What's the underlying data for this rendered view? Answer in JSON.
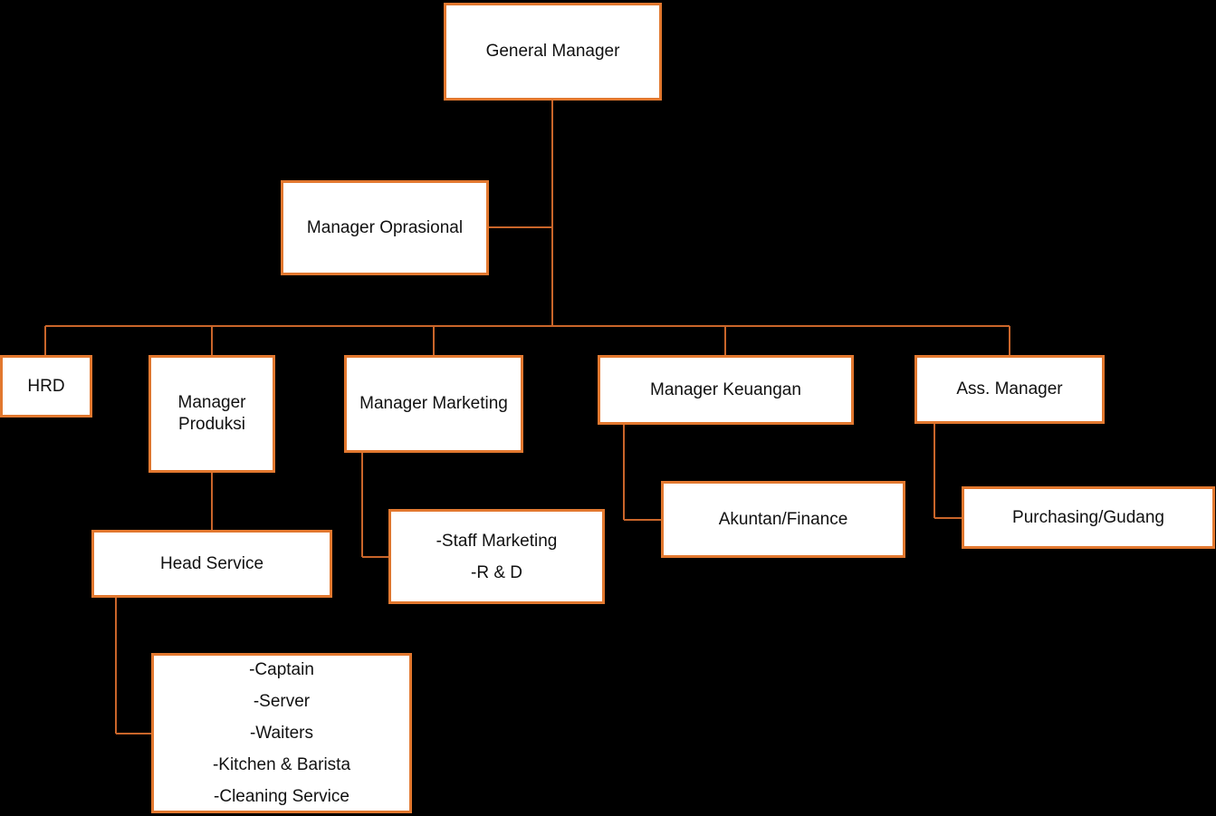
{
  "colors": {
    "border": "#e2782f",
    "connector": "#c9652a",
    "background": "#000000",
    "box_fill": "#ffffff"
  },
  "nodes": {
    "general_manager": "General Manager",
    "manager_oprasional": "Manager Oprasional",
    "hrd": "HRD",
    "manager_produksi": [
      "Manager",
      "Produksi"
    ],
    "manager_marketing": "Manager Marketing",
    "manager_keuangan": "Manager Keuangan",
    "ass_manager": "Ass. Manager",
    "head_service": "Head Service",
    "staff_marketing": [
      "-Staff Marketing",
      "-R & D"
    ],
    "akuntan": "Akuntan/Finance",
    "purchasing": "Purchasing/Gudang",
    "service_staff": [
      "-Captain",
      "-Server",
      "-Waiters",
      "-Kitchen & Barista",
      "-Cleaning Service"
    ]
  }
}
